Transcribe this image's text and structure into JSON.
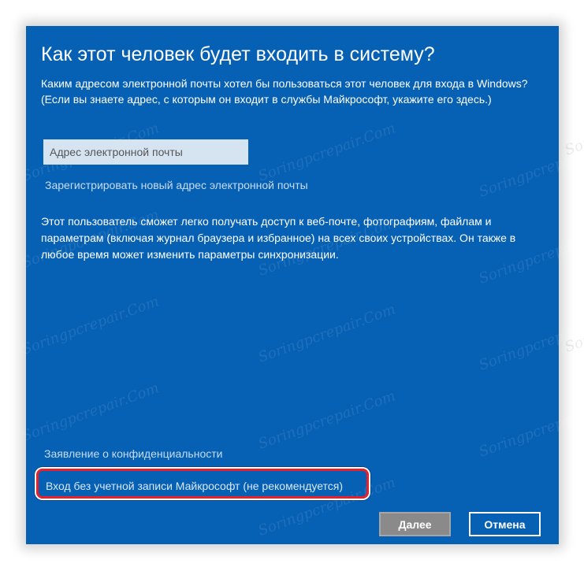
{
  "dialog": {
    "title": "Как этот человек будет входить в систему?",
    "description": "Каким адресом электронной почты хотел бы пользоваться этот человек для входа в Windows? (Если вы знаете адрес, с которым он входит в службы Майкрософт, укажите его здесь.)",
    "email_field": {
      "placeholder": "Адрес электронной почты",
      "value": ""
    },
    "register_link": "Зарегистрировать новый адрес электронной почты",
    "info": "Этот пользователь сможет легко получать доступ к веб-почте, фотографиям, файлам и параметрам (включая журнал браузера и избранное) на всех своих устройствах. Он также в любое время может изменить параметры синхронизации.",
    "privacy_link": "Заявление о конфиденциальности",
    "offline_link": "Вход без учетной записи Майкрософт (не рекомендуется)",
    "buttons": {
      "next": "Далее",
      "cancel": "Отмена"
    }
  },
  "watermark": "Soringpcrepair.Com",
  "colors": {
    "dialog_background": "#0660b4",
    "link": "#c7dcf0",
    "highlight": "#e8202a",
    "next_button": "#8a8a8a"
  }
}
